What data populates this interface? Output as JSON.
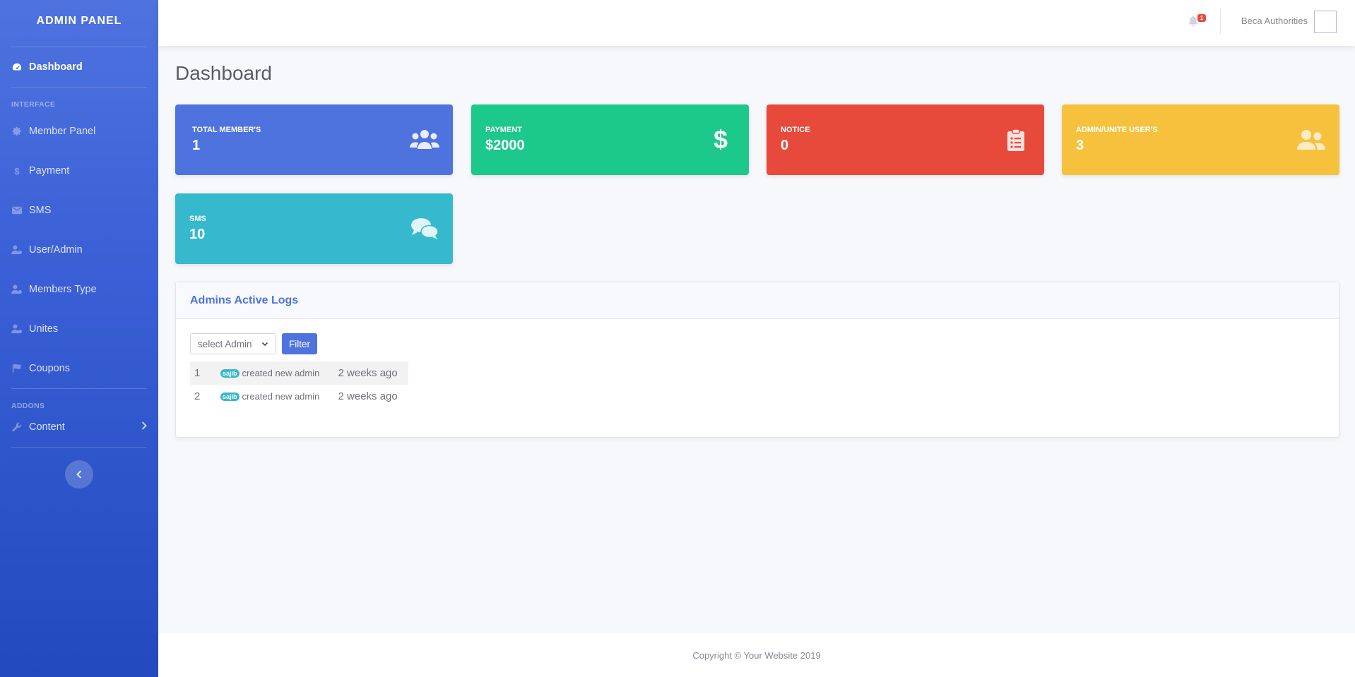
{
  "sidebar": {
    "brand": "ADMIN PANEL",
    "dashboard": "Dashboard",
    "heading_interface": "INTERFACE",
    "items": [
      {
        "label": "Member Panel",
        "icon": "gear-icon"
      },
      {
        "label": "Payment",
        "icon": "dollar-icon"
      },
      {
        "label": "SMS",
        "icon": "envelope-icon"
      },
      {
        "label": "User/Admin",
        "icon": "user-cog-icon"
      },
      {
        "label": "Members Type",
        "icon": "user-cog-icon"
      },
      {
        "label": "Unites",
        "icon": "user-cog-icon"
      },
      {
        "label": "Coupons",
        "icon": "flag-icon"
      }
    ],
    "heading_addons": "ADDONS",
    "content": "Content"
  },
  "topbar": {
    "notification_count": "1",
    "user_name": "Beca Authorities"
  },
  "page": {
    "title": "Dashboard"
  },
  "cards": [
    {
      "label": "TOTAL MEMBER'S",
      "value": "1",
      "color": "#4e73df",
      "icon": "users-icon"
    },
    {
      "label": "PAYMENT",
      "value": "$2000",
      "color": "#1cc88a",
      "icon": "dollar-icon"
    },
    {
      "label": "NOTICE",
      "value": "0",
      "color": "#e74a3b",
      "icon": "clipboard-list-icon"
    },
    {
      "label": "ADMIN/UNITE USER'S",
      "value": "3",
      "color": "#f6c23e",
      "icon": "user-friends-icon"
    },
    {
      "label": "SMS",
      "value": "10",
      "color": "#36b9cc",
      "icon": "comments-icon"
    }
  ],
  "logs_panel": {
    "title": "Admins Active Logs",
    "select_value": "select Admin",
    "filter_label": "Filter",
    "rows": [
      {
        "index": "1",
        "user": "sajib",
        "action": "created new admin",
        "time": "2 weeks ago"
      },
      {
        "index": "2",
        "user": "sajib",
        "action": "created new admin",
        "time": "2 weeks ago"
      }
    ]
  },
  "footer": {
    "text": "Copyright © Your Website 2019"
  }
}
